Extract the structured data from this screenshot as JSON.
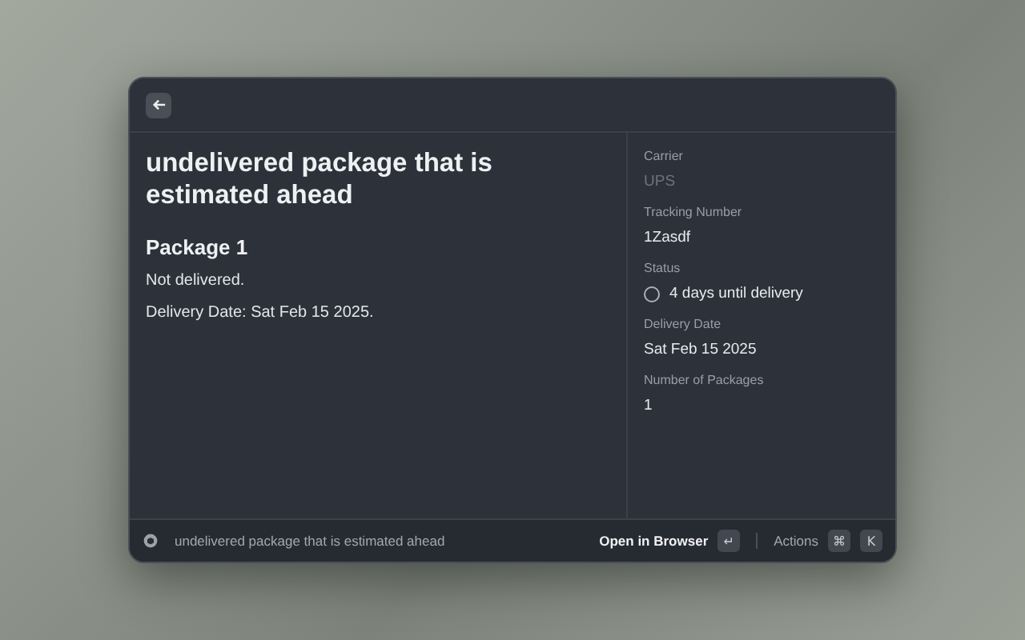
{
  "detail": {
    "title": "undelivered package that is estimated ahead",
    "sections": [
      {
        "heading": "Package 1",
        "lines": [
          "Not delivered.",
          "Delivery Date: Sat Feb 15 2025."
        ]
      }
    ]
  },
  "metadata": [
    {
      "label": "Carrier",
      "value": "UPS",
      "kind": "text",
      "muted": true
    },
    {
      "label": "Tracking Number",
      "value": "1Zasdf",
      "kind": "text",
      "muted": false
    },
    {
      "label": "Status",
      "value": "4 days until delivery",
      "kind": "status",
      "muted": false
    },
    {
      "label": "Delivery Date",
      "value": "Sat Feb 15 2025",
      "kind": "text",
      "muted": false
    },
    {
      "label": "Number of Packages",
      "value": "1",
      "kind": "text",
      "muted": false
    }
  ],
  "footer": {
    "title": "undelivered package that is estimated ahead",
    "primary_action": {
      "label": "Open in Browser",
      "keys": [
        "↵"
      ]
    },
    "actions": {
      "label": "Actions",
      "keys": [
        "⌘",
        "K"
      ]
    }
  }
}
